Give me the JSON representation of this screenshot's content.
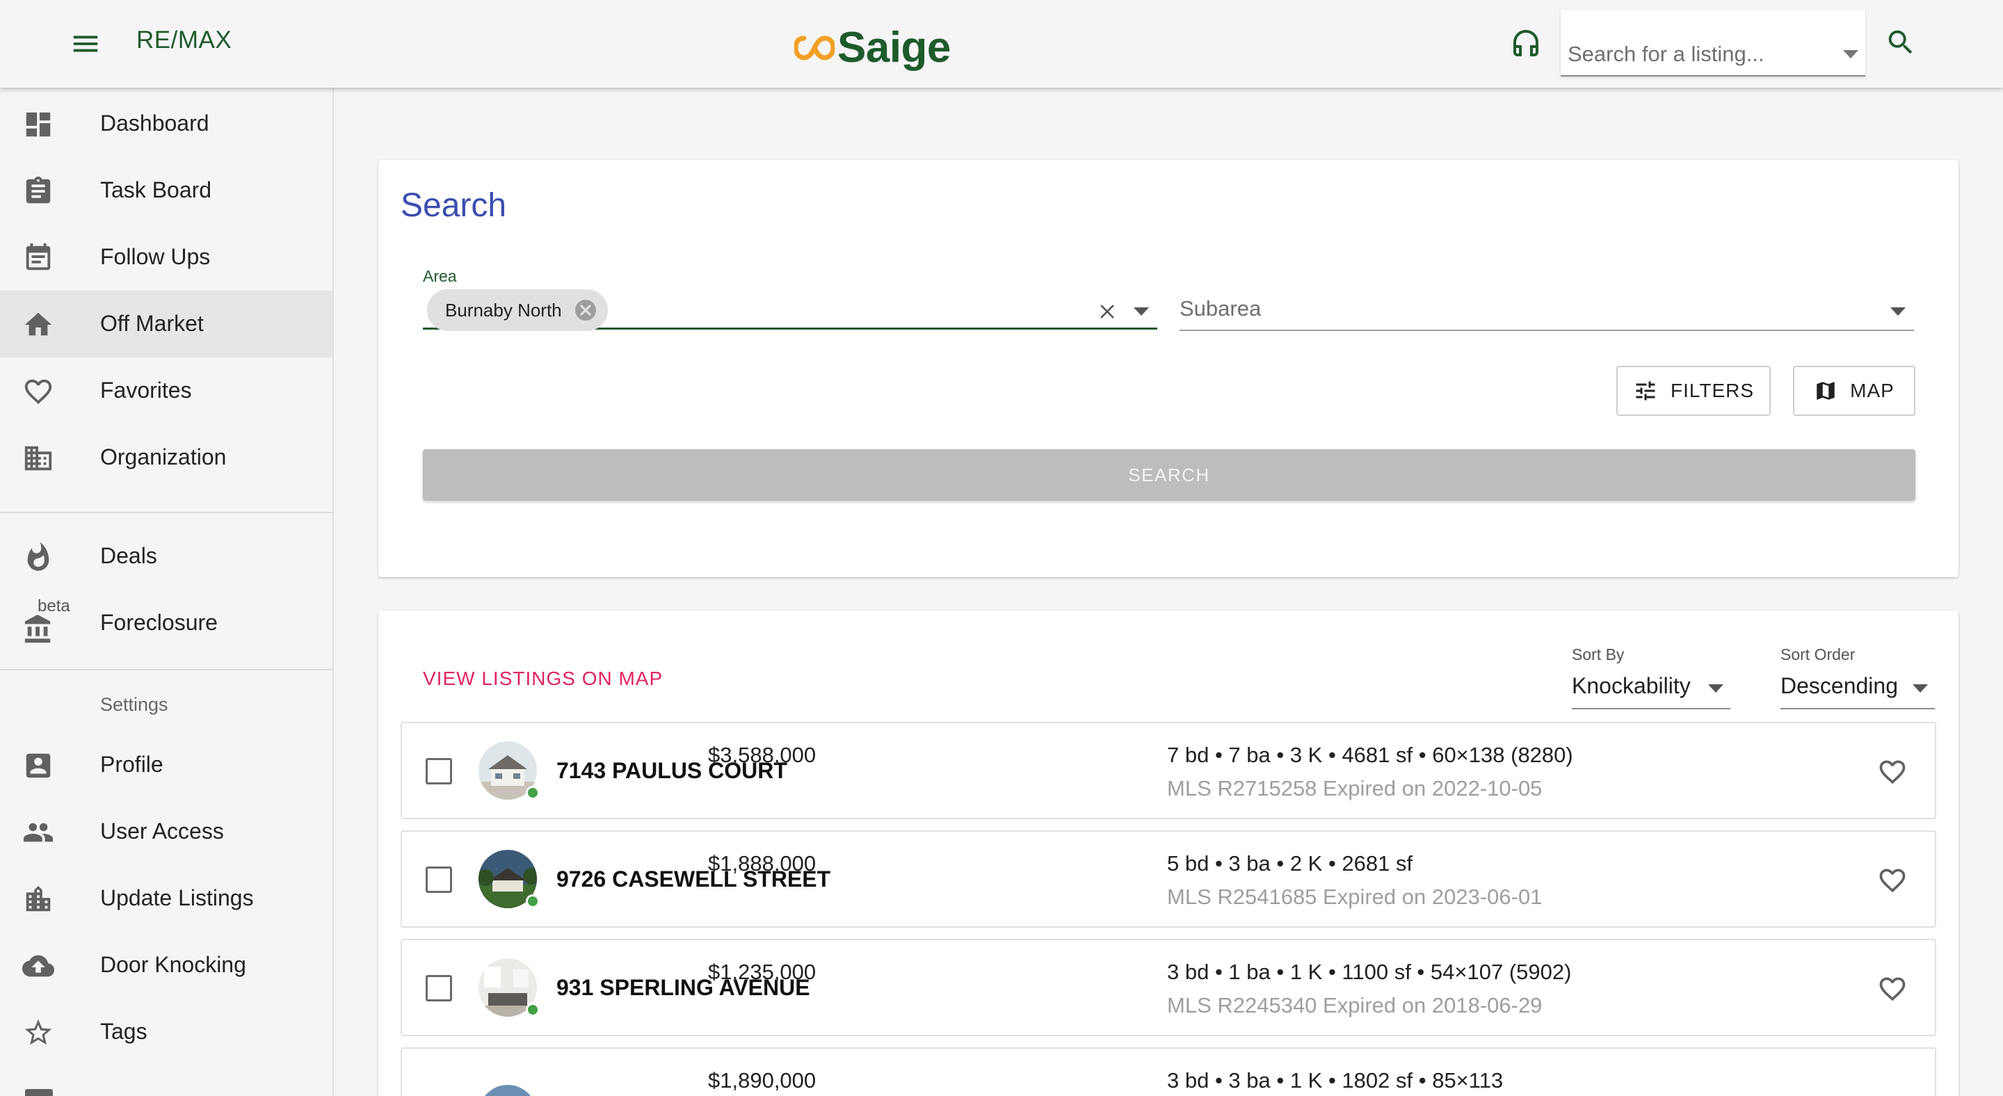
{
  "header": {
    "brand": "RE/MAX",
    "logo_text": "Saige",
    "search_placeholder": "Search for a listing...",
    "icons": [
      "menu-icon",
      "headset-icon",
      "search-icon"
    ]
  },
  "sidebar": {
    "items": [
      {
        "label": "Dashboard",
        "icon": "dashboard-icon"
      },
      {
        "label": "Task Board",
        "icon": "clipboard-icon"
      },
      {
        "label": "Follow Ups",
        "icon": "calendar-icon"
      },
      {
        "label": "Off Market",
        "icon": "home-icon",
        "active": true
      },
      {
        "label": "Favorites",
        "icon": "heart-icon"
      },
      {
        "label": "Organization",
        "icon": "building-icon"
      }
    ],
    "items2": [
      {
        "label": "Deals",
        "icon": "fire-icon"
      },
      {
        "label": "Foreclosure",
        "icon": "bank-icon",
        "badge": "beta"
      }
    ],
    "settings_header": "Settings",
    "settings_items": [
      {
        "label": "Profile",
        "icon": "profile-icon"
      },
      {
        "label": "User Access",
        "icon": "people-icon"
      },
      {
        "label": "Update Listings",
        "icon": "city-icon"
      },
      {
        "label": "Door Knocking",
        "icon": "cloud-upload-icon"
      },
      {
        "label": "Tags",
        "icon": "star-icon"
      }
    ]
  },
  "search": {
    "title": "Search",
    "area_label": "Area",
    "area_chip": "Burnaby North",
    "subarea_placeholder": "Subarea",
    "filters_label": "FILTERS",
    "map_label": "MAP",
    "search_label": "SEARCH"
  },
  "results": {
    "view_map_label": "VIEW LISTINGS ON MAP",
    "sort_by_label": "Sort By",
    "sort_by_value": "Knockability",
    "sort_order_label": "Sort Order",
    "sort_order_value": "Descending",
    "listings": [
      {
        "address": "7143 PAULUS COURT",
        "price": "$3,588,000",
        "specs": "7 bd • 7 ba • 3 K • 4681 sf • 60×138 (8280)",
        "mls": "MLS R2715258 Expired on 2022-10-05"
      },
      {
        "address": "9726 CASEWELL STREET",
        "price": "$1,888,000",
        "specs": "5 bd • 3 ba • 2 K • 2681 sf",
        "mls": "MLS R2541685 Expired on 2023-06-01"
      },
      {
        "address": "931 SPERLING AVENUE",
        "price": "$1,235,000",
        "specs": "3 bd • 1 ba • 1 K • 1100 sf • 54×107 (5902)",
        "mls": "MLS R2245340 Expired on 2018-06-29"
      },
      {
        "address": "",
        "price": "$1,890,000",
        "specs": "3 bd • 3 ba • 1 K • 1802 sf • 85×113",
        "mls": ""
      }
    ]
  },
  "colors": {
    "brand_green": "#1f5a2d",
    "logo_orange": "#f2a024",
    "title_blue": "#3a4db0",
    "link_pink": "#e0245e",
    "status_green": "#43a047"
  }
}
